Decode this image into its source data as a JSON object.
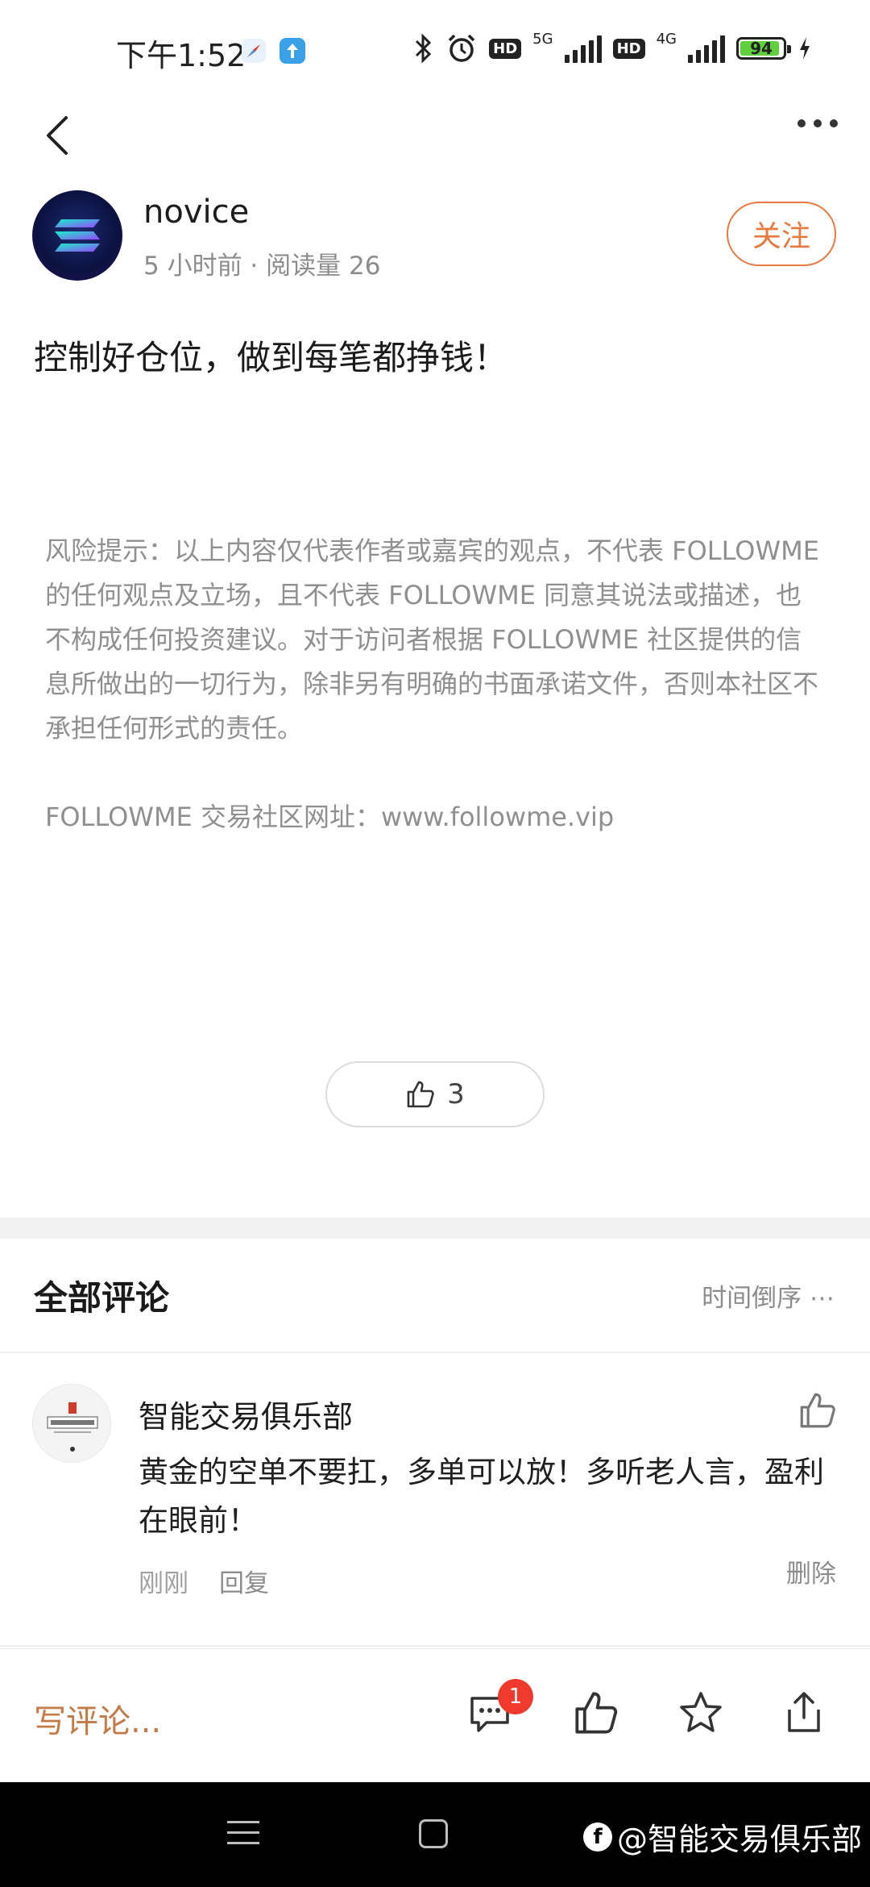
{
  "status_bar": {
    "time": "下午1:52",
    "network_1": "5G",
    "network_2": "4G",
    "hd": "HD",
    "battery": "94"
  },
  "post": {
    "author": "novice",
    "meta": "5 小时前 · 阅读量 26",
    "follow_label": "关注",
    "title": "控制好仓位，做到每笔都挣钱！",
    "risk_notice": "风险提示：以上内容仅代表作者或嘉宾的观点，不代表 FOLLOWME 的任何观点及立场，且不代表 FOLLOWME 同意其说法或描述，也不构成任何投资建议。对于访问者根据 FOLLOWME 社区提供的信息所做出的一切行为，除非另有明确的书面承诺文件，否则本社区不承担任何形式的责任。",
    "site": "FOLLOWME 交易社区网址：www.followme.vip",
    "like_count": "3"
  },
  "comments": {
    "title": "全部评论",
    "sort_label": "时间倒序",
    "items": [
      {
        "author": "智能交易俱乐部",
        "text": "黄金的空单不要扛，多单可以放！多听老人言，盈利在眼前！",
        "time": "刚刚",
        "reply": "回复",
        "delete": "删除"
      }
    ]
  },
  "action_bar": {
    "write_placeholder": "写评论...",
    "comment_badge": "1"
  },
  "watermark": "@智能交易俱乐部",
  "colors": {
    "accent": "#e6793f",
    "write_text": "#c27a47",
    "badge": "#f03a2e"
  }
}
